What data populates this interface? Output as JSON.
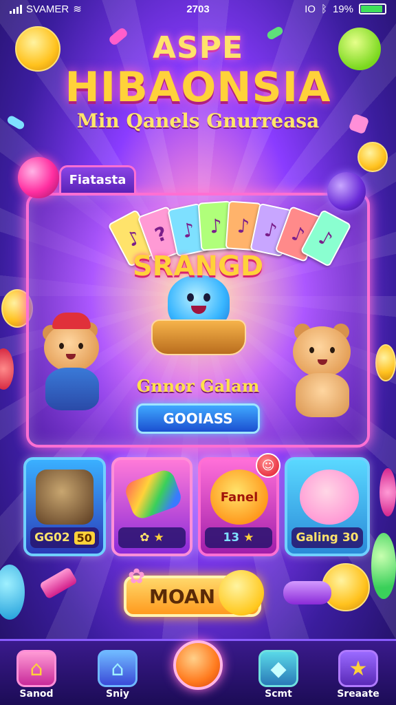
{
  "status_bar": {
    "carrier": "SVAMER",
    "time": "2703",
    "indicator": "IO",
    "battery_text": "19%",
    "battery_level": 0.9,
    "icons": [
      "signal-icon",
      "wifi-icon",
      "bluetooth-icon",
      "battery-icon"
    ]
  },
  "header": {
    "title_top": "ASPE",
    "title_main": "HIBAONSIA",
    "subtitle": "Min Qanels Gnurreasa"
  },
  "featured": {
    "tab_label": "Fiatasta",
    "logo_text": "SRANGD",
    "caption": "Gnnor Galam",
    "button_label": "GOOIASS",
    "card_glyphs": [
      "♪",
      "?",
      "♪",
      "♪",
      "♪",
      "♪",
      "♪",
      "♪"
    ],
    "card_colors": [
      "#ffe36b",
      "#ff9ad5",
      "#7ee0ff",
      "#b0ff7a",
      "#ffb36b",
      "#c8a6ff",
      "#ff8a8a",
      "#8affd0"
    ]
  },
  "tiles": [
    {
      "name": "tile-game-1",
      "label": "GG02",
      "badge": "50",
      "border": "#6fd0ff",
      "art": "#5a3aa8"
    },
    {
      "name": "tile-game-2",
      "label": "",
      "badge": "",
      "border": "#ff8fd8",
      "art": "#3ad0a0"
    },
    {
      "name": "tile-game-3",
      "label": "13",
      "badge": "",
      "border": "#ff6fd3",
      "art": "#ffb33a"
    },
    {
      "name": "tile-game-4",
      "label": "Galing",
      "badge": "30",
      "border": "#6fd0ff",
      "art": "#ff9ad5"
    }
  ],
  "tile3_art_text": "Fanel",
  "tile3_notification": "",
  "main_button": {
    "label": "MOAN"
  },
  "nav": [
    {
      "name": "nav-home",
      "label": "Sanod",
      "icon": "home-icon",
      "glyph": "⌂",
      "color": "#ff8fd8"
    },
    {
      "name": "nav-shop",
      "label": "Sniy",
      "icon": "shop-icon",
      "glyph": "⌂",
      "color": "#6fb8ff"
    },
    {
      "name": "nav-social",
      "label": "Scmt",
      "icon": "gem-icon",
      "glyph": "◆",
      "color": "#6fe0e0"
    },
    {
      "name": "nav-events",
      "label": "Sreaate",
      "icon": "star-icon",
      "glyph": "★",
      "color": "#b07aff"
    }
  ]
}
